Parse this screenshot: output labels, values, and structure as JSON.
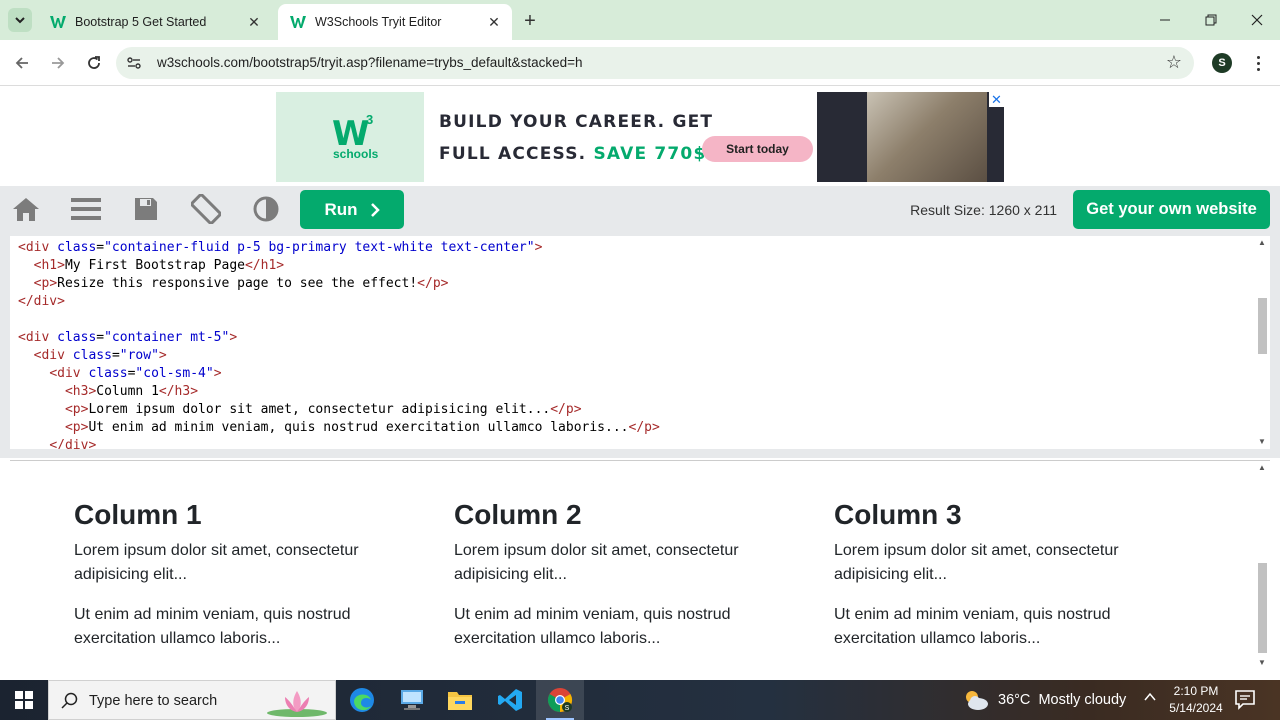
{
  "browser": {
    "tabs": [
      {
        "title": "Bootstrap 5 Get Started",
        "favicon": "w3schools-icon",
        "active": false
      },
      {
        "title": "W3Schools Tryit Editor",
        "favicon": "w3schools-icon",
        "active": true
      }
    ],
    "url": "w3schools.com/bootstrap5/tryit.asp?filename=trybs_default&stacked=h",
    "profile_initial": "S",
    "accent": "#d7ecd9"
  },
  "ad": {
    "logo_mark": "W",
    "logo_sup": "3",
    "logo_text": "schools",
    "line1": "BUILD YOUR CAREER. GET",
    "line2_prefix": "FULL ACCESS.",
    "line2_highlight": "SAVE 770$",
    "cta": "Start today",
    "close": "✕"
  },
  "toolbar": {
    "run_label": "Run",
    "result_size": "Result Size: 1260 x 211",
    "own_site_label": "Get your own website",
    "accent": "#04aa6d"
  },
  "editor": {
    "lines": [
      "<div class=\"container-fluid p-5 bg-primary text-white text-center\">",
      "  <h1>My First Bootstrap Page</h1>",
      "  <p>Resize this responsive page to see the effect!</p>",
      "</div>",
      "",
      "<div class=\"container mt-5\">",
      "  <div class=\"row\">",
      "    <div class=\"col-sm-4\">",
      "      <h3>Column 1</h3>",
      "      <p>Lorem ipsum dolor sit amet, consectetur adipisicing elit...</p>",
      "      <p>Ut enim ad minim veniam, quis nostrud exercitation ullamco laboris...</p>",
      "    </div>"
    ]
  },
  "result": {
    "columns": [
      {
        "heading": "Column 1",
        "p1": "Lorem ipsum dolor sit amet, consectetur adipisicing elit...",
        "p2": "Ut enim ad minim veniam, quis nostrud exercitation ullamco laboris..."
      },
      {
        "heading": "Column 2",
        "p1": "Lorem ipsum dolor sit amet, consectetur adipisicing elit...",
        "p2": "Ut enim ad minim veniam, quis nostrud exercitation ullamco laboris..."
      },
      {
        "heading": "Column 3",
        "p1": "Lorem ipsum dolor sit amet, consectetur adipisicing elit...",
        "p2": "Ut enim ad minim veniam, quis nostrud exercitation ullamco laboris..."
      }
    ]
  },
  "taskbar": {
    "search_placeholder": "Type here to search",
    "apps": [
      "edge-icon",
      "network-app-icon",
      "file-explorer-icon",
      "vscode-icon",
      "chrome-icon"
    ],
    "weather": "36°C  Mostly cloudy",
    "time": "2:10 PM",
    "date": "5/14/2024"
  }
}
